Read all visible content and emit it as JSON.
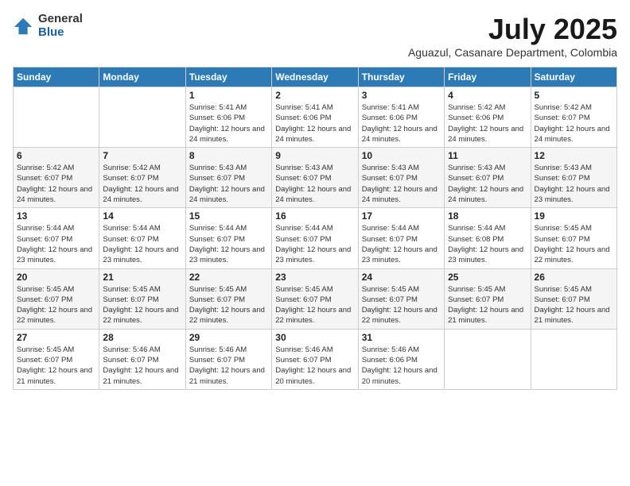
{
  "logo": {
    "general": "General",
    "blue": "Blue"
  },
  "header": {
    "month": "July 2025",
    "location": "Aguazul, Casanare Department, Colombia"
  },
  "weekdays": [
    "Sunday",
    "Monday",
    "Tuesday",
    "Wednesday",
    "Thursday",
    "Friday",
    "Saturday"
  ],
  "weeks": [
    [
      {
        "day": "",
        "info": ""
      },
      {
        "day": "",
        "info": ""
      },
      {
        "day": "1",
        "info": "Sunrise: 5:41 AM\nSunset: 6:06 PM\nDaylight: 12 hours and 24 minutes."
      },
      {
        "day": "2",
        "info": "Sunrise: 5:41 AM\nSunset: 6:06 PM\nDaylight: 12 hours and 24 minutes."
      },
      {
        "day": "3",
        "info": "Sunrise: 5:41 AM\nSunset: 6:06 PM\nDaylight: 12 hours and 24 minutes."
      },
      {
        "day": "4",
        "info": "Sunrise: 5:42 AM\nSunset: 6:06 PM\nDaylight: 12 hours and 24 minutes."
      },
      {
        "day": "5",
        "info": "Sunrise: 5:42 AM\nSunset: 6:07 PM\nDaylight: 12 hours and 24 minutes."
      }
    ],
    [
      {
        "day": "6",
        "info": "Sunrise: 5:42 AM\nSunset: 6:07 PM\nDaylight: 12 hours and 24 minutes."
      },
      {
        "day": "7",
        "info": "Sunrise: 5:42 AM\nSunset: 6:07 PM\nDaylight: 12 hours and 24 minutes."
      },
      {
        "day": "8",
        "info": "Sunrise: 5:43 AM\nSunset: 6:07 PM\nDaylight: 12 hours and 24 minutes."
      },
      {
        "day": "9",
        "info": "Sunrise: 5:43 AM\nSunset: 6:07 PM\nDaylight: 12 hours and 24 minutes."
      },
      {
        "day": "10",
        "info": "Sunrise: 5:43 AM\nSunset: 6:07 PM\nDaylight: 12 hours and 24 minutes."
      },
      {
        "day": "11",
        "info": "Sunrise: 5:43 AM\nSunset: 6:07 PM\nDaylight: 12 hours and 24 minutes."
      },
      {
        "day": "12",
        "info": "Sunrise: 5:43 AM\nSunset: 6:07 PM\nDaylight: 12 hours and 23 minutes."
      }
    ],
    [
      {
        "day": "13",
        "info": "Sunrise: 5:44 AM\nSunset: 6:07 PM\nDaylight: 12 hours and 23 minutes."
      },
      {
        "day": "14",
        "info": "Sunrise: 5:44 AM\nSunset: 6:07 PM\nDaylight: 12 hours and 23 minutes."
      },
      {
        "day": "15",
        "info": "Sunrise: 5:44 AM\nSunset: 6:07 PM\nDaylight: 12 hours and 23 minutes."
      },
      {
        "day": "16",
        "info": "Sunrise: 5:44 AM\nSunset: 6:07 PM\nDaylight: 12 hours and 23 minutes."
      },
      {
        "day": "17",
        "info": "Sunrise: 5:44 AM\nSunset: 6:07 PM\nDaylight: 12 hours and 23 minutes."
      },
      {
        "day": "18",
        "info": "Sunrise: 5:44 AM\nSunset: 6:08 PM\nDaylight: 12 hours and 23 minutes."
      },
      {
        "day": "19",
        "info": "Sunrise: 5:45 AM\nSunset: 6:07 PM\nDaylight: 12 hours and 22 minutes."
      }
    ],
    [
      {
        "day": "20",
        "info": "Sunrise: 5:45 AM\nSunset: 6:07 PM\nDaylight: 12 hours and 22 minutes."
      },
      {
        "day": "21",
        "info": "Sunrise: 5:45 AM\nSunset: 6:07 PM\nDaylight: 12 hours and 22 minutes."
      },
      {
        "day": "22",
        "info": "Sunrise: 5:45 AM\nSunset: 6:07 PM\nDaylight: 12 hours and 22 minutes."
      },
      {
        "day": "23",
        "info": "Sunrise: 5:45 AM\nSunset: 6:07 PM\nDaylight: 12 hours and 22 minutes."
      },
      {
        "day": "24",
        "info": "Sunrise: 5:45 AM\nSunset: 6:07 PM\nDaylight: 12 hours and 22 minutes."
      },
      {
        "day": "25",
        "info": "Sunrise: 5:45 AM\nSunset: 6:07 PM\nDaylight: 12 hours and 21 minutes."
      },
      {
        "day": "26",
        "info": "Sunrise: 5:45 AM\nSunset: 6:07 PM\nDaylight: 12 hours and 21 minutes."
      }
    ],
    [
      {
        "day": "27",
        "info": "Sunrise: 5:45 AM\nSunset: 6:07 PM\nDaylight: 12 hours and 21 minutes."
      },
      {
        "day": "28",
        "info": "Sunrise: 5:46 AM\nSunset: 6:07 PM\nDaylight: 12 hours and 21 minutes."
      },
      {
        "day": "29",
        "info": "Sunrise: 5:46 AM\nSunset: 6:07 PM\nDaylight: 12 hours and 21 minutes."
      },
      {
        "day": "30",
        "info": "Sunrise: 5:46 AM\nSunset: 6:07 PM\nDaylight: 12 hours and 20 minutes."
      },
      {
        "day": "31",
        "info": "Sunrise: 5:46 AM\nSunset: 6:06 PM\nDaylight: 12 hours and 20 minutes."
      },
      {
        "day": "",
        "info": ""
      },
      {
        "day": "",
        "info": ""
      }
    ]
  ]
}
